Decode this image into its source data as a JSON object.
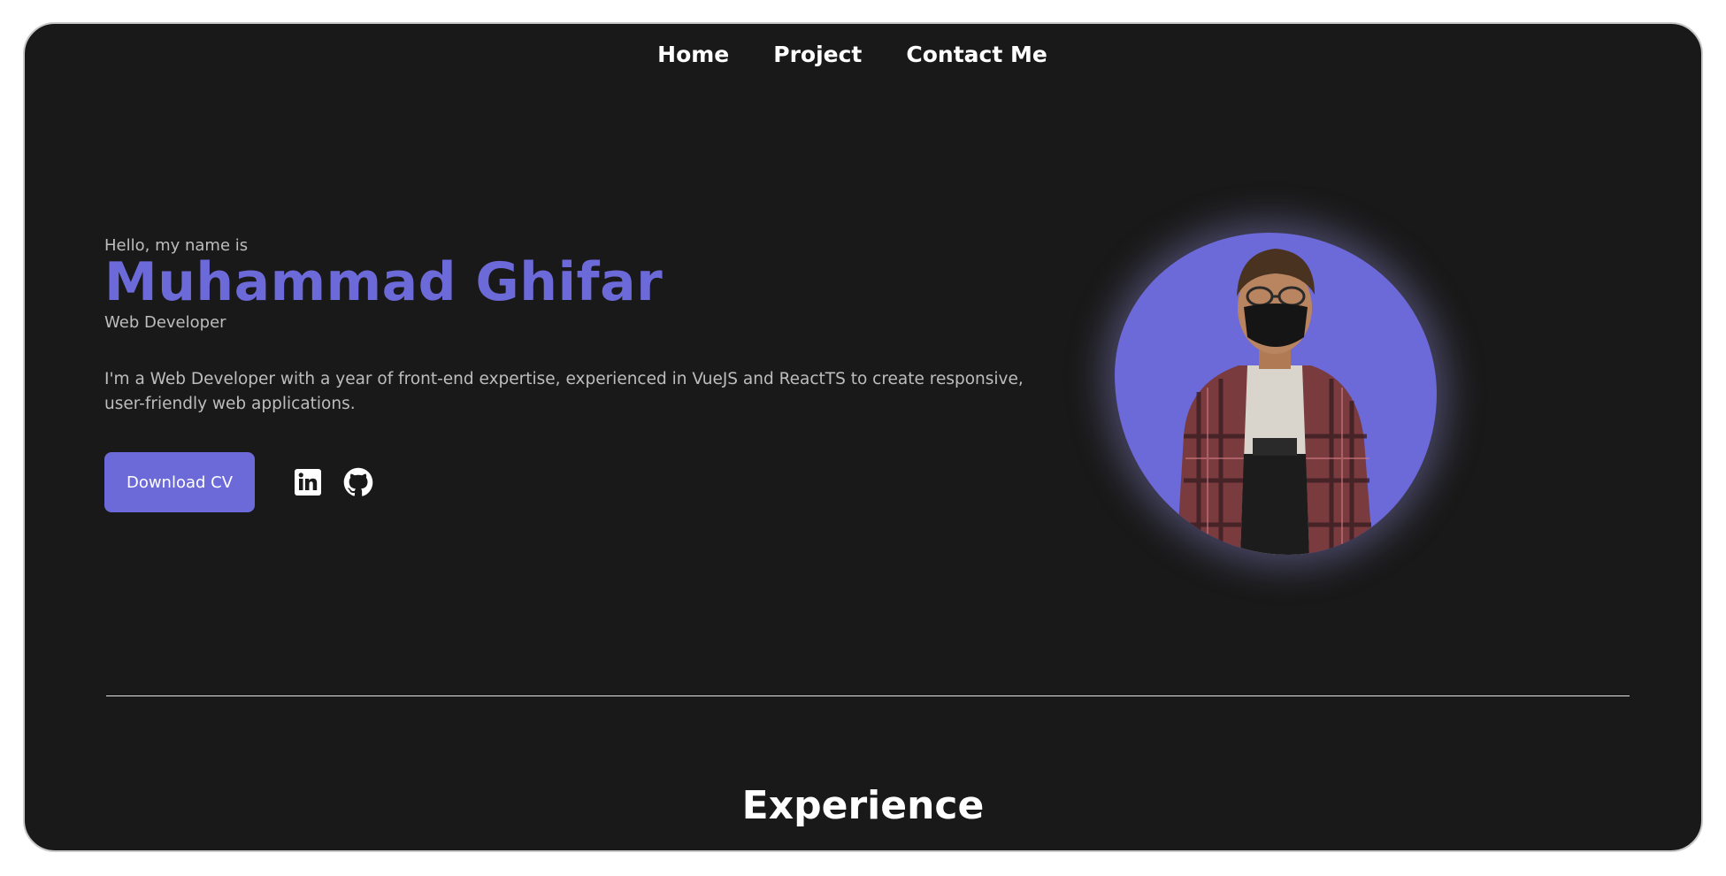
{
  "nav": {
    "items": [
      {
        "label": "Home"
      },
      {
        "label": "Project"
      },
      {
        "label": "Contact Me"
      }
    ]
  },
  "hero": {
    "greeting": "Hello, my name is",
    "name": "Muhammad Ghifar",
    "role": "Web Developer",
    "bio": "I'm a Web Developer with a year of front-end expertise, experienced in VueJS and ReactTS to create responsive, user-friendly web applications.",
    "cv_button": "Download CV",
    "social_icons": [
      "linkedin-icon",
      "github-icon"
    ]
  },
  "sections": {
    "experience_title": "Experience"
  },
  "colors": {
    "background": "#191919",
    "accent": "#6c69d9",
    "text_muted": "#bdbdbd",
    "text": "#ffffff"
  }
}
